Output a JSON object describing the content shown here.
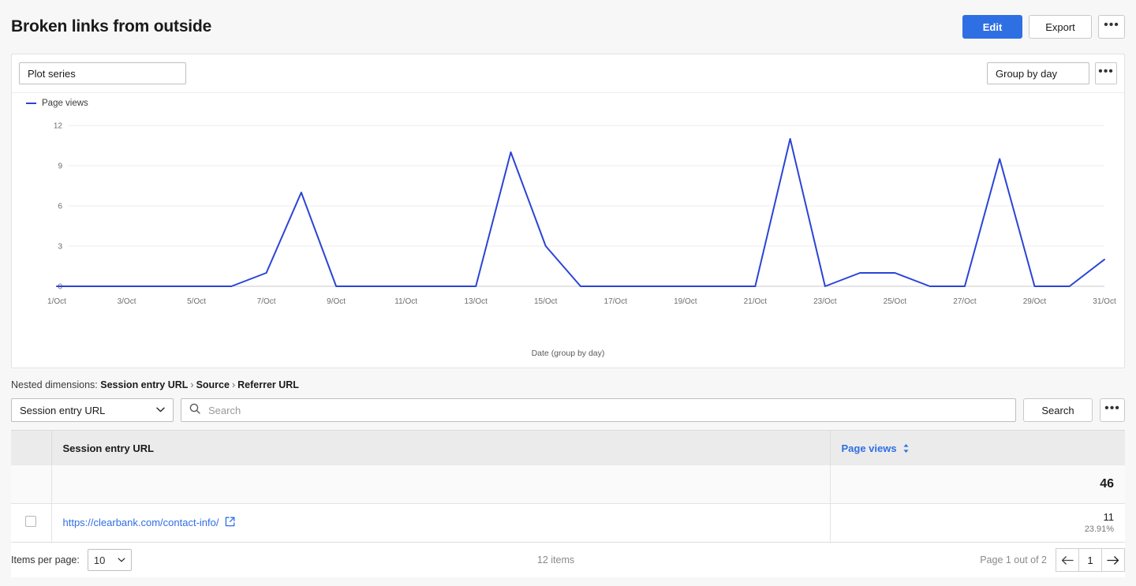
{
  "header": {
    "title": "Broken links from outside",
    "edit_label": "Edit",
    "export_label": "Export",
    "more_label": "•••"
  },
  "chart_toolbar": {
    "plot_series_label": "Plot series",
    "group_by_label": "Group by day",
    "more_label": "•••"
  },
  "chart_data": {
    "type": "line",
    "title": "",
    "legend": [
      "Page views"
    ],
    "legend_position": "top-left",
    "series_color": "#2b44d6",
    "xlabel": "Date (group by day)",
    "ylabel": "",
    "ylim": [
      0,
      12
    ],
    "yticks": [
      0,
      3,
      6,
      9,
      12
    ],
    "grid": true,
    "xticks": [
      "1/Oct",
      "3/Oct",
      "5/Oct",
      "7/Oct",
      "9/Oct",
      "11/Oct",
      "13/Oct",
      "15/Oct",
      "17/Oct",
      "19/Oct",
      "21/Oct",
      "23/Oct",
      "25/Oct",
      "27/Oct",
      "29/Oct",
      "31/Oct"
    ],
    "categories": [
      "1/Oct",
      "2/Oct",
      "3/Oct",
      "4/Oct",
      "5/Oct",
      "6/Oct",
      "7/Oct",
      "8/Oct",
      "9/Oct",
      "10/Oct",
      "11/Oct",
      "12/Oct",
      "13/Oct",
      "14/Oct",
      "15/Oct",
      "16/Oct",
      "17/Oct",
      "18/Oct",
      "19/Oct",
      "20/Oct",
      "21/Oct",
      "22/Oct",
      "23/Oct",
      "24/Oct",
      "25/Oct",
      "26/Oct",
      "27/Oct",
      "28/Oct",
      "29/Oct",
      "30/Oct",
      "31/Oct"
    ],
    "series": [
      {
        "name": "Page views",
        "values": [
          0,
          0,
          0,
          0,
          0,
          0,
          1,
          7,
          0,
          0,
          0,
          0,
          0,
          10,
          3,
          0,
          0,
          0,
          0,
          0,
          0,
          11,
          0,
          1,
          1,
          0,
          0,
          9.5,
          0,
          0,
          2
        ]
      }
    ]
  },
  "nested_dimensions": {
    "label": "Nested dimensions:",
    "path": [
      "Session entry URL",
      "Source",
      "Referrer URL"
    ],
    "separator": "›"
  },
  "table_controls": {
    "dimension_selected": "Session entry URL",
    "search_value": "",
    "search_placeholder": "Search",
    "search_button": "Search",
    "more_label": "•••"
  },
  "table": {
    "columns": [
      "Session entry URL",
      "Page views"
    ],
    "total": {
      "dimension": "",
      "page_views": "46"
    },
    "rows": [
      {
        "url": "https://clearbank.com/contact-info/",
        "page_views": "11",
        "percent": "23.91%"
      }
    ]
  },
  "footer": {
    "items_per_page_label": "Items per page:",
    "items_per_page_value": "10",
    "item_count": "12 items",
    "page_status": "Page 1 out of 2",
    "current_page": "1",
    "prev_label": "←",
    "next_label": "→"
  }
}
